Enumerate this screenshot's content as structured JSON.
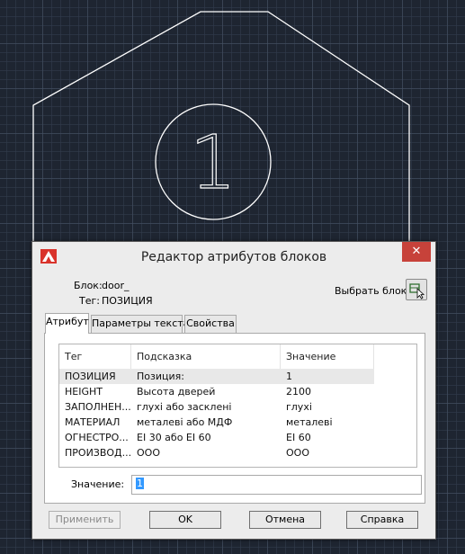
{
  "dialog": {
    "title": "Редактор атрибутов блоков",
    "block_label": "Блок:",
    "block_value": "door_",
    "tag_label": "Тег:",
    "tag_value": "ПОЗИЦИЯ",
    "pick_block_label": "Выбрать блок",
    "tabs": [
      {
        "label": "Атрибут",
        "active": true
      },
      {
        "label": "Параметры текста",
        "active": false
      },
      {
        "label": "Свойства",
        "active": false
      }
    ],
    "table": {
      "columns": [
        "Тег",
        "Подсказка",
        "Значение"
      ],
      "rows": [
        {
          "tag": "ПОЗИЦИЯ",
          "prompt": "Позиция:",
          "value": "1",
          "selected": true
        },
        {
          "tag": "HEIGHT",
          "prompt": "Высота дверей",
          "value": "2100"
        },
        {
          "tag": "ЗАПОЛНЕН...",
          "prompt": "глухі або засклені",
          "value": "глухі"
        },
        {
          "tag": "МАТЕРИАЛ",
          "prompt": "металеві або МДФ",
          "value": "металеві"
        },
        {
          "tag": "ОГНЕСТРО...",
          "prompt": "ЕІ 30 або ЕІ 60",
          "value": "ЕІ 60"
        },
        {
          "tag": "ПРОИЗВОД...",
          "prompt": "ООО",
          "value": "ООО"
        }
      ]
    },
    "value_label": "Значение:",
    "value_field": "1",
    "buttons": {
      "apply": "Применить",
      "ok": "OK",
      "cancel": "Отмена",
      "help": "Справка"
    },
    "colors": {
      "close": "#c7423a",
      "selection": "#3399ff",
      "app_icon": "#d9332b"
    }
  },
  "drawing": {
    "circle_label": "1"
  },
  "icons": [
    "autocad-app-icon",
    "close-icon",
    "pick-block-icon"
  ]
}
